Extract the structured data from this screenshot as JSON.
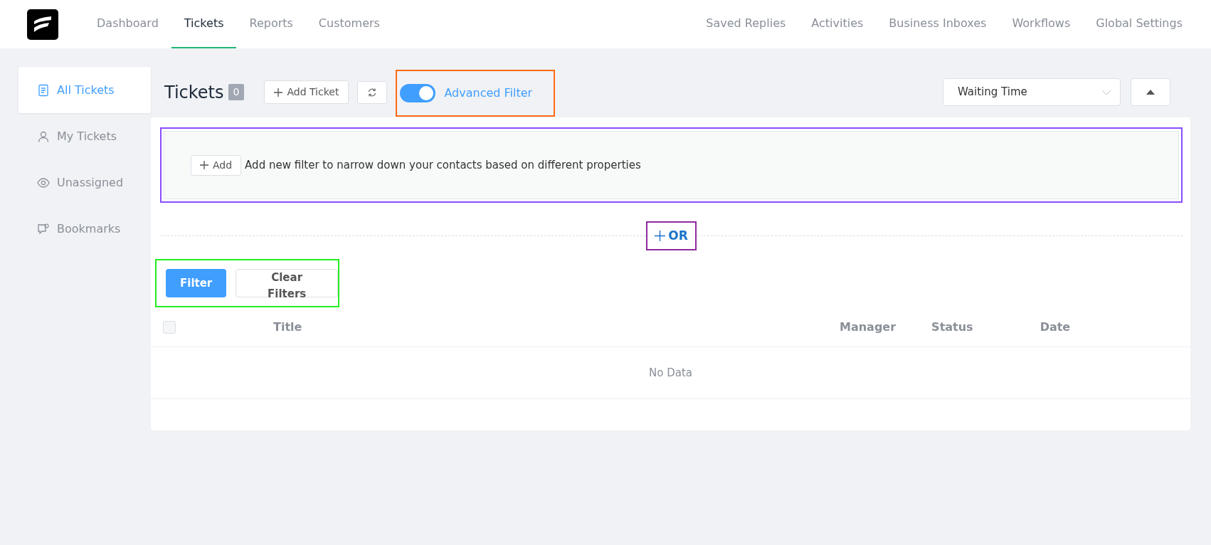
{
  "nav": {
    "left": [
      {
        "label": "Dashboard",
        "selected": false
      },
      {
        "label": "Tickets",
        "selected": true
      },
      {
        "label": "Reports",
        "selected": false
      },
      {
        "label": "Customers",
        "selected": false
      }
    ],
    "right": [
      {
        "label": "Saved Replies"
      },
      {
        "label": "Activities"
      },
      {
        "label": "Business Inboxes"
      },
      {
        "label": "Workflows"
      },
      {
        "label": "Global Settings"
      }
    ]
  },
  "sidebar": {
    "items": [
      {
        "label": "All Tickets",
        "kind": "document",
        "selected": true
      },
      {
        "label": "My Tickets",
        "kind": "person",
        "selected": false
      },
      {
        "label": "Unassigned",
        "kind": "eye",
        "selected": false
      },
      {
        "label": "Bookmarks",
        "kind": "bookmark",
        "selected": false
      }
    ]
  },
  "header": {
    "title": "Tickets",
    "count": "0",
    "add_button": "Add Ticket",
    "advanced_filter": {
      "label": "Advanced Filter",
      "on": true
    },
    "sort_select": {
      "value": "Waiting Time"
    }
  },
  "filter": {
    "add_button": "Add",
    "hint": "Add new filter to narrow down your contacts based on different properties",
    "or_button": "OR",
    "buttons": [
      {
        "label": "Filter",
        "kind": "primary"
      },
      {
        "label": "Clear Filters",
        "kind": "secondary"
      }
    ]
  },
  "table": {
    "select_all_checked": false,
    "columns": [
      "Title",
      "Manager",
      "Status",
      "Date"
    ],
    "empty_text": "No Data"
  }
}
